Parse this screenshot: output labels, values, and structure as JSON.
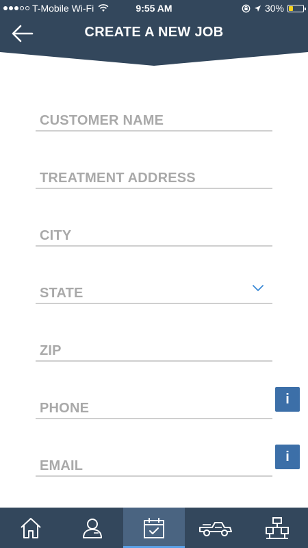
{
  "status_bar": {
    "carrier": "T-Mobile Wi-Fi",
    "time": "9:55 AM",
    "battery": "30%",
    "battery_level": 0.3,
    "signal_bars": 3
  },
  "header": {
    "title": "CREATE A NEW JOB",
    "back_icon": "arrow-left-icon"
  },
  "form": {
    "fields": [
      {
        "label": "CUSTOMER NAME"
      },
      {
        "label": "TREATMENT ADDRESS"
      },
      {
        "label": "CITY"
      },
      {
        "label": "STATE",
        "icon": "chevron-down-icon"
      },
      {
        "label": "ZIP"
      },
      {
        "label": "PHONE",
        "info_label": "i"
      },
      {
        "label": "EMAIL",
        "info_label": "i"
      }
    ]
  },
  "tabbar": {
    "tabs": [
      {
        "icon": "home-icon"
      },
      {
        "icon": "user-icon"
      },
      {
        "icon": "calendar-check-icon",
        "active": true
      },
      {
        "icon": "truck-icon"
      },
      {
        "icon": "org-chart-icon"
      }
    ]
  },
  "colors": {
    "header_bg": "#33475c",
    "accent": "#3c6fa8",
    "tab_active": "#4a6481",
    "placeholder": "#a9a9a9",
    "underline": "#cfcfcf"
  }
}
